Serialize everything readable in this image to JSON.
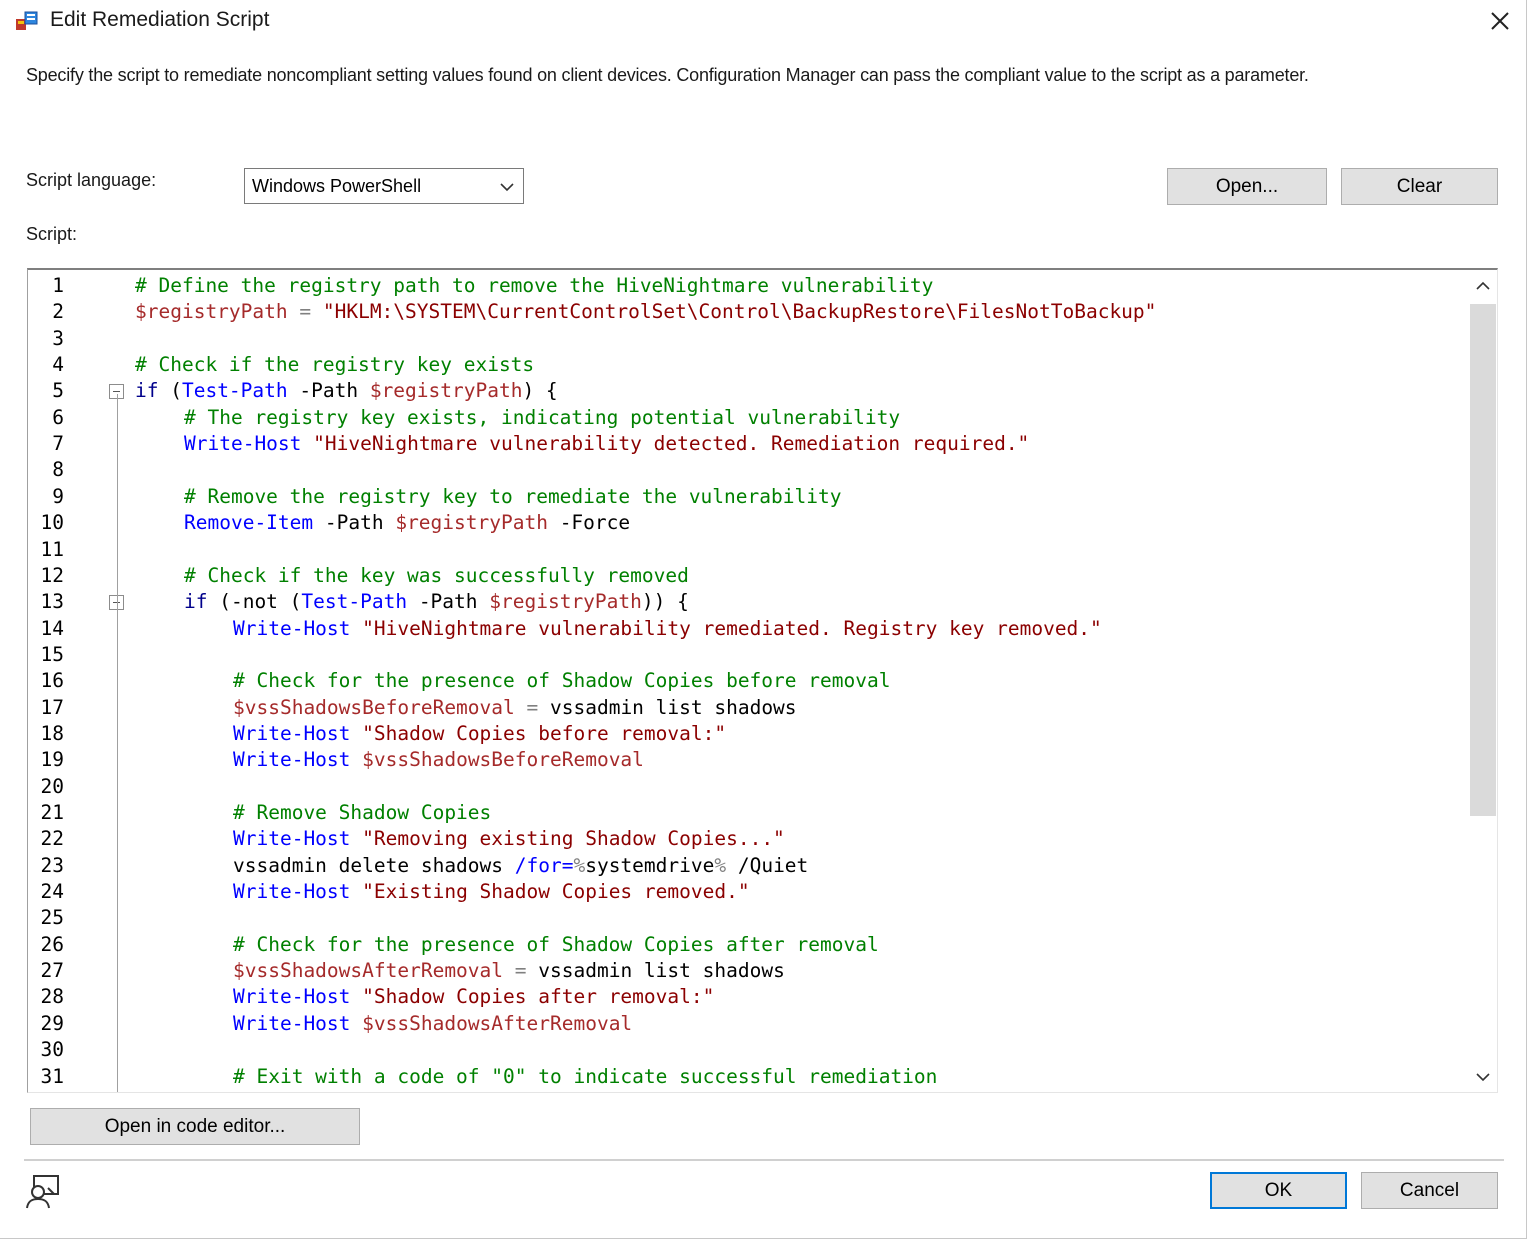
{
  "window": {
    "title": "Edit Remediation Script",
    "app_icon": "sccm-app-icon",
    "close_icon": "close-icon"
  },
  "description": "Specify the script to remediate noncompliant setting values found on client devices. Configuration Manager can pass the compliant value to the script as a parameter.",
  "script_language": {
    "label": "Script language:",
    "selected": "Windows PowerShell"
  },
  "buttons": {
    "open": "Open...",
    "clear": "Clear",
    "open_code_editor": "Open in code editor...",
    "ok": "OK",
    "cancel": "Cancel"
  },
  "script": {
    "label": "Script:",
    "lines": [
      {
        "n": "1",
        "indent": 0,
        "tokens": [
          [
            "c",
            "# Define the registry path to remove the HiveNightmare vulnerability"
          ]
        ]
      },
      {
        "n": "2",
        "indent": 0,
        "tokens": [
          [
            "v",
            "$registryPath"
          ],
          [
            "o",
            " = "
          ],
          [
            "s",
            "\"HKLM:\\SYSTEM\\CurrentControlSet\\Control\\BackupRestore\\FilesNotToBackup\""
          ]
        ]
      },
      {
        "n": "3",
        "indent": 0,
        "tokens": []
      },
      {
        "n": "4",
        "indent": 0,
        "tokens": [
          [
            "c",
            "# Check if the registry key exists"
          ]
        ]
      },
      {
        "n": "5",
        "indent": 0,
        "fold": true,
        "tokens": [
          [
            "k",
            "if"
          ],
          [
            "p",
            " ("
          ],
          [
            "m",
            "Test-Path"
          ],
          [
            "p",
            " -Path "
          ],
          [
            "v",
            "$registryPath"
          ],
          [
            "p",
            ") {"
          ]
        ]
      },
      {
        "n": "6",
        "indent": 1,
        "tokens": [
          [
            "c",
            "# The registry key exists, indicating potential vulnerability"
          ]
        ]
      },
      {
        "n": "7",
        "indent": 1,
        "tokens": [
          [
            "m",
            "Write-Host"
          ],
          [
            "p",
            " "
          ],
          [
            "s",
            "\"HiveNightmare vulnerability detected. Remediation required.\""
          ]
        ]
      },
      {
        "n": "8",
        "indent": 1,
        "tokens": []
      },
      {
        "n": "9",
        "indent": 1,
        "tokens": [
          [
            "c",
            "# Remove the registry key to remediate the vulnerability"
          ]
        ]
      },
      {
        "n": "10",
        "indent": 1,
        "tokens": [
          [
            "m",
            "Remove-Item"
          ],
          [
            "p",
            " -Path "
          ],
          [
            "v",
            "$registryPath"
          ],
          [
            "p",
            " -Force"
          ]
        ]
      },
      {
        "n": "11",
        "indent": 1,
        "tokens": []
      },
      {
        "n": "12",
        "indent": 1,
        "tokens": [
          [
            "c",
            "# Check if the key was successfully removed"
          ]
        ]
      },
      {
        "n": "13",
        "indent": 1,
        "fold": true,
        "tokens": [
          [
            "k",
            "if"
          ],
          [
            "p",
            " (-not ("
          ],
          [
            "m",
            "Test-Path"
          ],
          [
            "p",
            " -Path "
          ],
          [
            "v",
            "$registryPath"
          ],
          [
            "p",
            ")) {"
          ]
        ]
      },
      {
        "n": "14",
        "indent": 2,
        "tokens": [
          [
            "m",
            "Write-Host"
          ],
          [
            "p",
            " "
          ],
          [
            "s",
            "\"HiveNightmare vulnerability remediated. Registry key removed.\""
          ]
        ]
      },
      {
        "n": "15",
        "indent": 2,
        "tokens": []
      },
      {
        "n": "16",
        "indent": 2,
        "tokens": [
          [
            "c",
            "# Check for the presence of Shadow Copies before removal"
          ]
        ]
      },
      {
        "n": "17",
        "indent": 2,
        "tokens": [
          [
            "v",
            "$vssShadowsBeforeRemoval"
          ],
          [
            "o",
            " = "
          ],
          [
            "p",
            "vssadmin list shadows"
          ]
        ]
      },
      {
        "n": "18",
        "indent": 2,
        "tokens": [
          [
            "m",
            "Write-Host"
          ],
          [
            "p",
            " "
          ],
          [
            "s",
            "\"Shadow Copies before removal:\""
          ]
        ]
      },
      {
        "n": "19",
        "indent": 2,
        "tokens": [
          [
            "m",
            "Write-Host"
          ],
          [
            "p",
            " "
          ],
          [
            "v",
            "$vssShadowsBeforeRemoval"
          ]
        ]
      },
      {
        "n": "20",
        "indent": 2,
        "tokens": []
      },
      {
        "n": "21",
        "indent": 2,
        "tokens": [
          [
            "c",
            "# Remove Shadow Copies"
          ]
        ]
      },
      {
        "n": "22",
        "indent": 2,
        "tokens": [
          [
            "m",
            "Write-Host"
          ],
          [
            "p",
            " "
          ],
          [
            "s",
            "\"Removing existing Shadow Copies...\""
          ]
        ]
      },
      {
        "n": "23",
        "indent": 2,
        "tokens": [
          [
            "p",
            "vssadmin delete shadows "
          ],
          [
            "m",
            "/for="
          ],
          [
            "o",
            "%"
          ],
          [
            "p",
            "systemdrive"
          ],
          [
            "o",
            "%"
          ],
          [
            "p",
            " /Quiet"
          ]
        ]
      },
      {
        "n": "24",
        "indent": 2,
        "tokens": [
          [
            "m",
            "Write-Host"
          ],
          [
            "p",
            " "
          ],
          [
            "s",
            "\"Existing Shadow Copies removed.\""
          ]
        ]
      },
      {
        "n": "25",
        "indent": 2,
        "tokens": []
      },
      {
        "n": "26",
        "indent": 2,
        "tokens": [
          [
            "c",
            "# Check for the presence of Shadow Copies after removal"
          ]
        ]
      },
      {
        "n": "27",
        "indent": 2,
        "tokens": [
          [
            "v",
            "$vssShadowsAfterRemoval"
          ],
          [
            "o",
            " = "
          ],
          [
            "p",
            "vssadmin list shadows"
          ]
        ]
      },
      {
        "n": "28",
        "indent": 2,
        "tokens": [
          [
            "m",
            "Write-Host"
          ],
          [
            "p",
            " "
          ],
          [
            "s",
            "\"Shadow Copies after removal:\""
          ]
        ]
      },
      {
        "n": "29",
        "indent": 2,
        "tokens": [
          [
            "m",
            "Write-Host"
          ],
          [
            "p",
            " "
          ],
          [
            "v",
            "$vssShadowsAfterRemoval"
          ]
        ]
      },
      {
        "n": "30",
        "indent": 2,
        "tokens": []
      },
      {
        "n": "31",
        "indent": 2,
        "tokens": [
          [
            "c",
            "# Exit with a code of \"0\" to indicate successful remediation"
          ]
        ]
      }
    ]
  },
  "icons": {
    "combo_arrow": "chevron-down-icon",
    "scroll_up": "chevron-up-icon",
    "scroll_down": "chevron-down-icon",
    "bottom_left": "user-help-icon"
  }
}
